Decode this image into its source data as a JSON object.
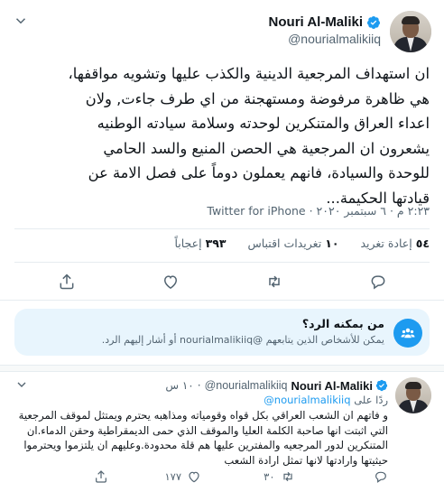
{
  "tweet": {
    "display_name": "Nouri Al-Maliki",
    "handle": "@nourialmalikiiq",
    "text_lines": [
      "ان استهداف المرجعية الدينية والكذب عليها وتشويه مواقفها،",
      "هي ظاهرة مرفوضة ومستهجنة من اي طرف جاءت, ولان",
      "اعداء العراق والمتنكرين لوحدته وسلامة سيادته الوطنيه",
      "يشعرون ان المرجعية هي الحصن المنيع والسد الحامي",
      "للوحدة والسيادة، فانهم يعملون دوماً على فصل الامة عن",
      "قيادتها الحكيمة..."
    ],
    "timestamp": "٢:٢٣ م · ٦ سبتمبر ٢٠٢٠",
    "meta_sep": " · ",
    "source": "Twitter for iPhone",
    "retweets_count": "٥٤",
    "retweets_label": "إعادة تغريد",
    "quotes_count": "١٠",
    "quotes_label": "تغريدات اقتباس",
    "likes_count": "٣٩٣",
    "likes_label": "إعجاباً"
  },
  "who_can_reply": {
    "title": "من بمكنه الرد؟",
    "description": "يمكن للأشخاص الذين يتابعهم @nourialmalikiiq أو أشار إليهم الرد."
  },
  "reply": {
    "display_name": "Nouri Al-Maliki",
    "handle": "@nourialmalikiiq",
    "dot": "·",
    "time": "١٠ س",
    "replying_to_label": "ردًا على",
    "replying_to_handle": "@nourialmalikiiq",
    "text": "و فاتهم ان الشعب العراقي بكل قواه وقومياته ومذاهبه يحترم ويمتثل لموقف المرجعية التي اثبتت انها صاحبة الكلمة العليا والموقف الذي حمى الديمقراطية وحقن الدماء.ان المتنكرين لدور المرجعيه والمفترين عليها هم قلة محدودة.وعليهم ان يلتزموا ويحترموا حيثيتها وارادتها لانها تمثل ارادة الشعب",
    "retweets_count": "٣٠",
    "likes_count": "١٧٧"
  },
  "colors": {
    "accent": "#1d9bf0",
    "secondary_text": "#536471",
    "reply_box_bg": "#e8f5fd"
  },
  "icons": {
    "verified": "verified-badge-icon",
    "more": "chevron-down-icon",
    "reply": "reply-bubble-icon",
    "retweet": "retweet-icon",
    "like": "heart-icon",
    "share": "share-icon",
    "people": "people-icon"
  }
}
